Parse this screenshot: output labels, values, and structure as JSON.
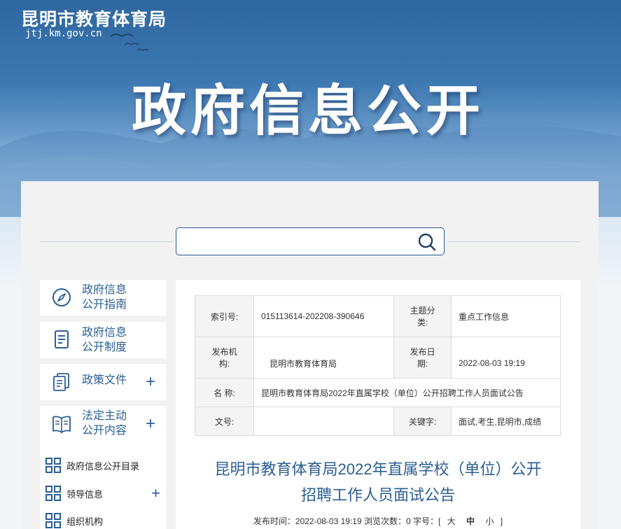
{
  "header": {
    "site_name": "昆明市教育体育局",
    "domain": "jtj.km.gov.cn",
    "banner_title": "政府信息公开"
  },
  "search": {
    "placeholder": ""
  },
  "sidebar": {
    "cards": [
      {
        "line1": "政府信息",
        "line2": "公开指南",
        "icon": "compass-icon"
      },
      {
        "line1": "政府信息",
        "line2": "公开制度",
        "icon": "document-icon"
      },
      {
        "line1": "政策文件",
        "line2": "",
        "icon": "files-icon",
        "plus": "+"
      },
      {
        "line1": "法定主动",
        "line2": "公开内容",
        "icon": "book-icon",
        "plus": "+"
      }
    ],
    "sub_items": [
      {
        "label": "政府信息公开目录"
      },
      {
        "label": "领导信息",
        "plus": "+"
      },
      {
        "label": "组织机构"
      }
    ]
  },
  "meta": {
    "index_label": "索引号:",
    "index_value": "015113614-202208-390646",
    "topic_label_1": "主题分",
    "topic_label_2": "类:",
    "topic_value": "重点工作信息",
    "publisher_label_1": "发布机",
    "publisher_label_2": "构:",
    "publisher_value": "昆明市教育体育局",
    "date_label_1": "发布日",
    "date_label_2": "期:",
    "date_value": "2022-08-03 19:19",
    "name_label": "名 称:",
    "name_value": "昆明市教育体育局2022年直属学校（单位）公开招聘工作人员面试公告",
    "docno_label": "文号:",
    "docno_value": "",
    "keywords_label": "关键字:",
    "keywords_value": "面试,考生,昆明市,成绩"
  },
  "article": {
    "title_line1": "昆明市教育体育局2022年直属学校（单位）公开",
    "title_line2": "招聘工作人员面试公告",
    "info_prefix": "发布时间：2022-08-03 19:19 浏览次数：0 字号：[",
    "size_large": "大",
    "size_medium": "中",
    "size_small": "小",
    "info_suffix": "]"
  },
  "colors": {
    "accent": "#2a5e95",
    "banner": "#3d78b1"
  }
}
